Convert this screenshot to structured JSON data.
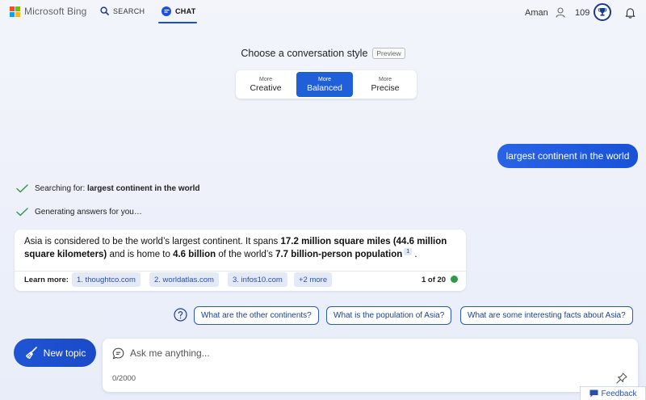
{
  "header": {
    "brand": "Microsoft Bing",
    "nav": {
      "search_label": "SEARCH",
      "chat_label": "CHAT"
    },
    "user_name": "Aman",
    "points": "109",
    "colors": {
      "ms_red": "#f25022",
      "ms_green": "#7fba00",
      "ms_blue": "#00a4ef",
      "ms_yellow": "#ffb900",
      "accent": "#174ae4"
    }
  },
  "conversation_style": {
    "title": "Choose a conversation style",
    "badge": "Preview",
    "options": [
      {
        "small": "More",
        "label": "Creative",
        "selected": false
      },
      {
        "small": "More",
        "label": "Balanced",
        "selected": true
      },
      {
        "small": "More",
        "label": "Precise",
        "selected": false
      }
    ]
  },
  "user_message": "largest continent in the world",
  "status": {
    "searching_prefix": "Searching for: ",
    "searching_query": "largest continent in the world",
    "generating": "Generating answers for you…"
  },
  "answer": {
    "part1": "Asia is considered to be the world’s largest continent. It spans ",
    "bold1": "17.2 million square miles (44.6 million square kilometers)",
    "part2": " and is home to ",
    "bold2": "4.6 billion",
    "part3": " of the world’s ",
    "bold3": "7.7 billion-person population",
    "citation": "1",
    "part4": " .",
    "learn_more_label": "Learn more:",
    "sources": [
      "1. thoughtco.com",
      "2. worldatlas.com",
      "3. infos10.com",
      "+2 more"
    ],
    "count": "1 of 20",
    "count_dot_color": "#2f9a4b"
  },
  "suggestions": [
    "What are the other continents?",
    "What is the population of Asia?",
    "What are some interesting facts about Asia?"
  ],
  "composer": {
    "new_topic_label": "New topic",
    "placeholder": "Ask me anything...",
    "char_count": "0/2000"
  },
  "feedback_label": "Feedback"
}
